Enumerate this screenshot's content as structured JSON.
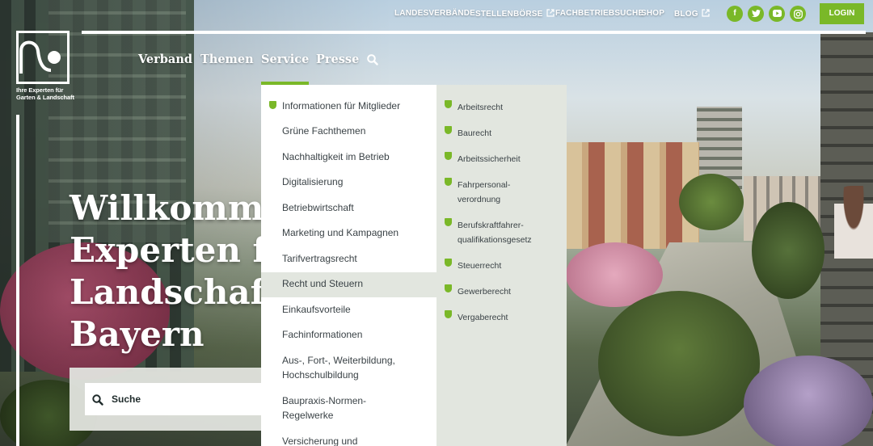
{
  "topbar": {
    "links": [
      {
        "label": "LANDESVERBÄNDE",
        "external": false
      },
      {
        "label": "STELLENBÖRSE",
        "external": true
      },
      {
        "label": "FACHBETRIEBSUCHE",
        "external": false
      },
      {
        "label": "SHOP",
        "external": false
      },
      {
        "label": "BLOG",
        "external": true
      }
    ],
    "social": [
      "facebook-icon",
      "twitter-icon",
      "youtube-icon",
      "instagram-icon"
    ],
    "login_label": "LOGIN",
    "accent_color": "#7ab828"
  },
  "logo": {
    "tagline_1": "Ihre Experten für",
    "tagline_2": "Garten & Landschaft"
  },
  "nav": {
    "items": [
      "Verband",
      "Themen",
      "Service",
      "Presse"
    ],
    "active": "Service",
    "search_icon": "search-icon"
  },
  "hero": {
    "title_lines": [
      "Willkommen bei den",
      "Experten für",
      "Landschaftsbau in",
      "Bayern"
    ]
  },
  "search": {
    "placeholder": "Suche"
  },
  "dropdown": {
    "main_items": [
      "Informationen für Mitglieder",
      "Grüne Fachthemen",
      "Nachhaltigkeit im Betrieb",
      "Digitalisierung",
      "Betriebwirtschaft",
      "Marketing und Kampagnen",
      "Tarifvertragsrecht",
      "Recht und Steuern",
      "Einkaufsvorteile",
      "Fachinformationen",
      "Aus-, Fort-, Weiterbildung,|Hochschulbildung",
      "Baupraxis-Normen-|Regelwerke",
      "Versicherung und"
    ],
    "active_item": "Recht und Steuern",
    "sub_items": [
      "Arbeitsrecht",
      "Baurecht",
      "Arbeitssicherheit",
      "Fahrpersonal-|verordnung",
      "Berufskraftfahrer-|qualifikationsgesetz",
      "Steuerrecht",
      "Gewerberecht",
      "Vergaberecht"
    ]
  }
}
